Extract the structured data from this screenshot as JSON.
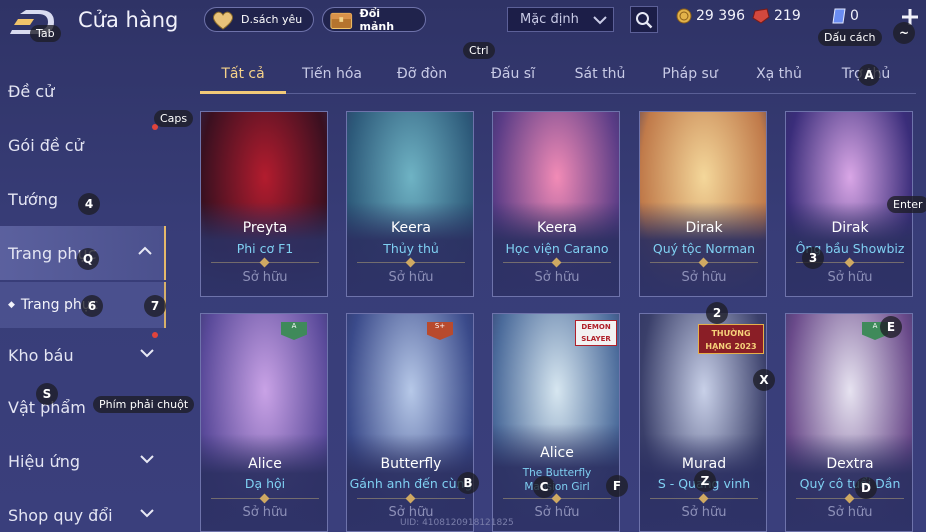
{
  "header": {
    "title": "Cửa hàng",
    "wishlist_label": "D.sách yêu",
    "exchange_label": "Đổi mảnh",
    "sort_value": "Mặc định",
    "coins": "29 396",
    "gems": "219",
    "vouchers": "0"
  },
  "hints": {
    "tab": "Tab",
    "ctrl": "Ctrl",
    "space": "Dấu cách",
    "tilde": "~",
    "caps": "Caps",
    "enter": "Enter",
    "right_click": "Phím phải chuột",
    "k_a": "A",
    "k_4": "4",
    "k_q": "Q",
    "k_6": "6",
    "k_7": "7",
    "k_s": "S",
    "k_3": "3",
    "k_2": "2",
    "k_e": "E",
    "k_x": "X",
    "k_b": "B",
    "k_c": "C",
    "k_f": "F",
    "k_z": "Z",
    "k_d": "D"
  },
  "sidebar": {
    "items": [
      {
        "label": "Đề cử"
      },
      {
        "label": "Gói đề cử"
      },
      {
        "label": "Tướng"
      },
      {
        "label": "Trang phục"
      },
      {
        "label": "Trang phục"
      },
      {
        "label": "Kho báu"
      },
      {
        "label": "Vật phẩm"
      },
      {
        "label": "Hiệu ứng"
      },
      {
        "label": "Shop quy đổi"
      }
    ]
  },
  "tabs": [
    {
      "label": "Tất cả"
    },
    {
      "label": "Tiến hóa"
    },
    {
      "label": "Đỡ đòn"
    },
    {
      "label": "Đấu sĩ"
    },
    {
      "label": "Sát thủ"
    },
    {
      "label": "Pháp sư"
    },
    {
      "label": "Xạ thủ"
    },
    {
      "label": "Trợ thủ"
    }
  ],
  "cards": [
    {
      "hero": "Preyta",
      "skin": "Phi cơ F1",
      "status": "Sở hữu",
      "color_a": "#b31c2e",
      "color_b": "#3a1020"
    },
    {
      "hero": "Keera",
      "skin": "Thủy thủ",
      "status": "Sở hữu",
      "color_a": "#6fb3c4",
      "color_b": "#2d5a7a"
    },
    {
      "hero": "Keera",
      "skin": "Học viện Carano",
      "status": "Sở hữu",
      "color_a": "#f28bb6",
      "color_b": "#5a3c86"
    },
    {
      "hero": "Dirak",
      "skin": "Quý tộc Norman",
      "status": "Sở hữu",
      "color_a": "#f4d79a",
      "color_b": "#c07a4a"
    },
    {
      "hero": "Dirak",
      "skin": "Ông bầu Showbiz",
      "status": "Sở hữu",
      "color_a": "#d9a6e6",
      "color_b": "#3a2d7a"
    },
    {
      "hero": "Alice",
      "skin": "Dạ hội",
      "status": "Sở hữu",
      "color_a": "#c9a2e6",
      "color_b": "#5a4a9a",
      "tier": "A"
    },
    {
      "hero": "Butterfly",
      "skin": "Gánh anh đến cùng",
      "status": "Sở hữu",
      "color_a": "#b6c8e8",
      "color_b": "#3a4a8a",
      "tier": "S+"
    },
    {
      "hero": "Alice",
      "skin": "The Butterfly Mansion Girl",
      "status": "Sở hữu",
      "color_a": "#d6e6f0",
      "color_b": "#4a6a9a",
      "badge": "DEMON SLAYER"
    },
    {
      "hero": "Murad",
      "skin": "S - Quang vinh",
      "status": "Sở hữu",
      "color_a": "#c8d0e8",
      "color_b": "#3a3f6a",
      "badge": "THƯỜNG HẠNG 2023"
    },
    {
      "hero": "Dextra",
      "skin": "Quý cô tuổi Dần",
      "status": "Sở hữu",
      "color_a": "#e6e2f0",
      "color_b": "#6a4a8a",
      "tier": "A"
    }
  ],
  "footer": {
    "uid": "UID: 4108120918121825"
  }
}
